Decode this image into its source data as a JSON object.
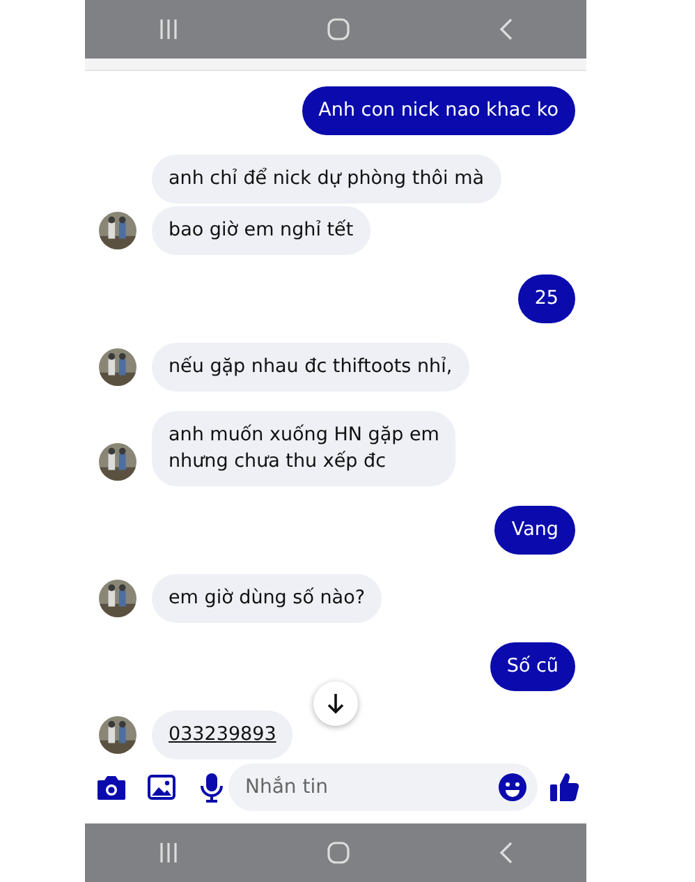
{
  "messages": [
    {
      "kind": "sent",
      "text": "Anh con nick nao khac ko"
    },
    {
      "kind": "received",
      "text": "anh chỉ để nick dự phòng thôi mà",
      "avatar": false
    },
    {
      "kind": "received",
      "text": "bao giờ em nghỉ tết",
      "avatar": true
    },
    {
      "kind": "sent",
      "text": "25"
    },
    {
      "kind": "received",
      "text": "nếu gặp nhau đc thiftoots nhỉ,",
      "avatar": true
    },
    {
      "kind": "received",
      "text": "anh muốn xuống HN gặp em\nnhưng chưa thu xếp đc",
      "avatar": true
    },
    {
      "kind": "sent",
      "text": "Vang"
    },
    {
      "kind": "received",
      "text": "em giờ dùng số nào?",
      "avatar": true
    },
    {
      "kind": "sent",
      "text": "Số cũ"
    },
    {
      "kind": "received",
      "text": "033239893",
      "avatar": true,
      "link": true
    }
  ],
  "composer": {
    "placeholder": "Nhắn tin"
  }
}
